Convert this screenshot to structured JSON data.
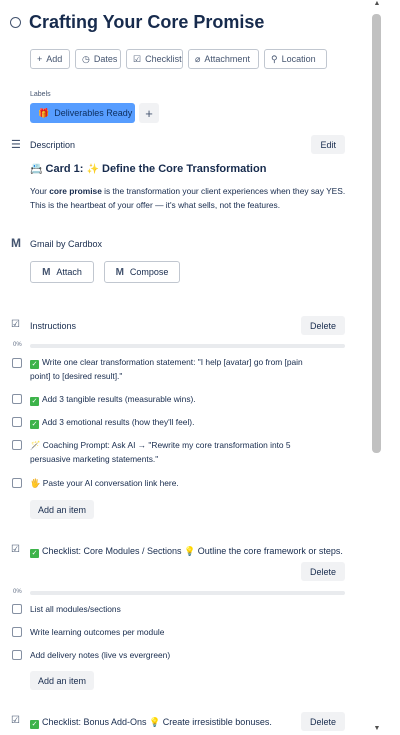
{
  "card": {
    "title": "Crafting Your Core Promise"
  },
  "actions": [
    {
      "icon": "plus-icon",
      "glyph": "+",
      "label": "Add"
    },
    {
      "icon": "clock-icon",
      "glyph": "◷",
      "label": "Dates"
    },
    {
      "icon": "checklist-icon",
      "glyph": "☑",
      "label": "Checklist"
    },
    {
      "icon": "paperclip-icon",
      "glyph": "⌀",
      "label": "Attachment"
    },
    {
      "icon": "location-icon",
      "glyph": "⚲",
      "label": "Location"
    }
  ],
  "labels": {
    "heading": "Labels",
    "chip": {
      "label": "Deliverables Ready",
      "color": "#579dff"
    },
    "add": "+"
  },
  "description": {
    "heading": "Description",
    "edit": "Edit",
    "card_heading": "Card 1: ",
    "card_heading_rest": " Define the Core Transformation",
    "text_pre": "Your ",
    "text_bold": "core promise",
    "text_post": " is the transformation your client experiences when they say YES. This is the heartbeat of your offer — it's what sells, not the features."
  },
  "gmail": {
    "heading": "Gmail by Cardbox",
    "attach": "Attach",
    "compose": "Compose"
  },
  "instructions": {
    "heading": "Instructions",
    "delete": "Delete",
    "progress": "0%",
    "progress_value": 0,
    "items": [
      "Write one clear transformation statement: \"I help [avatar] go from [pain point] to [desired result].\"",
      "Add 3 tangible results (measurable wins).",
      "Add 3 emotional results (how they'll feel).",
      "Coaching Prompt: Ask AI → \"Rewrite my core transformation into 5 persuasive marketing statements.\"",
      "Paste your AI conversation link here."
    ],
    "add_item": "Add an item"
  },
  "modules": {
    "heading": "Checklist: Core Modules / Sections ",
    "heading_rest": " Outline the core framework or steps.",
    "delete": "Delete",
    "progress": "0%",
    "progress_value": 0,
    "items": [
      "List all modules/sections",
      "Write learning outcomes per module",
      "Add delivery notes (live vs evergreen)"
    ],
    "add_item": "Add an item"
  },
  "bonus": {
    "heading": "Checklist: Bonus Add-Ons ",
    "heading_rest": " Create irresistible bonuses.",
    "delete": "Delete"
  },
  "scrollbar": {
    "up": "▲",
    "down": "▼"
  }
}
